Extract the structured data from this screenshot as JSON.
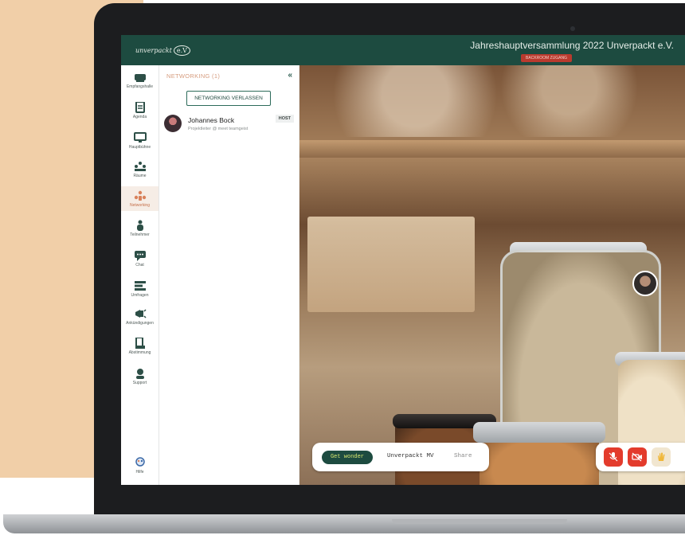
{
  "app": {
    "logo_text": "unverpackt",
    "logo_badge": "e.V",
    "event_title": "Jahreshauptversammlung 2022 Unverpackt e.V.",
    "breakout_badge": "BACKROOM ZUGANG"
  },
  "sidebar": {
    "items": [
      {
        "label": "Empfangshalle",
        "icon": "reception-icon"
      },
      {
        "label": "Agenda",
        "icon": "agenda-icon"
      },
      {
        "label": "Hauptbühne",
        "icon": "stage-icon"
      },
      {
        "label": "Räume",
        "icon": "rooms-icon"
      },
      {
        "label": "Networking",
        "icon": "networking-icon",
        "active": true
      },
      {
        "label": "Teilnehmer",
        "icon": "participant-icon"
      },
      {
        "label": "Chat",
        "icon": "chat-icon"
      },
      {
        "label": "Umfragen",
        "icon": "poll-icon"
      },
      {
        "label": "Ankündigungen",
        "icon": "megaphone-icon"
      },
      {
        "label": "Abstimmung",
        "icon": "vote-icon"
      },
      {
        "label": "Support",
        "icon": "support-icon"
      }
    ],
    "help_label": "Hilfe"
  },
  "panel": {
    "title": "NETWORKING (1)",
    "collapse": "«",
    "leave_button": "NETWORKING VERLASSEN",
    "participants": [
      {
        "name": "Johannes Bock",
        "role": "Projektleiter @ meet teamgeist",
        "badge": "HOST"
      }
    ]
  },
  "video": {
    "wonder_button": "Get wonder",
    "room_name": "Unverpackt MV",
    "share_label": "Share"
  },
  "colors": {
    "brand_green": "#1d4b40",
    "accent_orange": "#c56f4a",
    "alert_red": "#e33b2c",
    "peach": "#f1cfa8"
  }
}
